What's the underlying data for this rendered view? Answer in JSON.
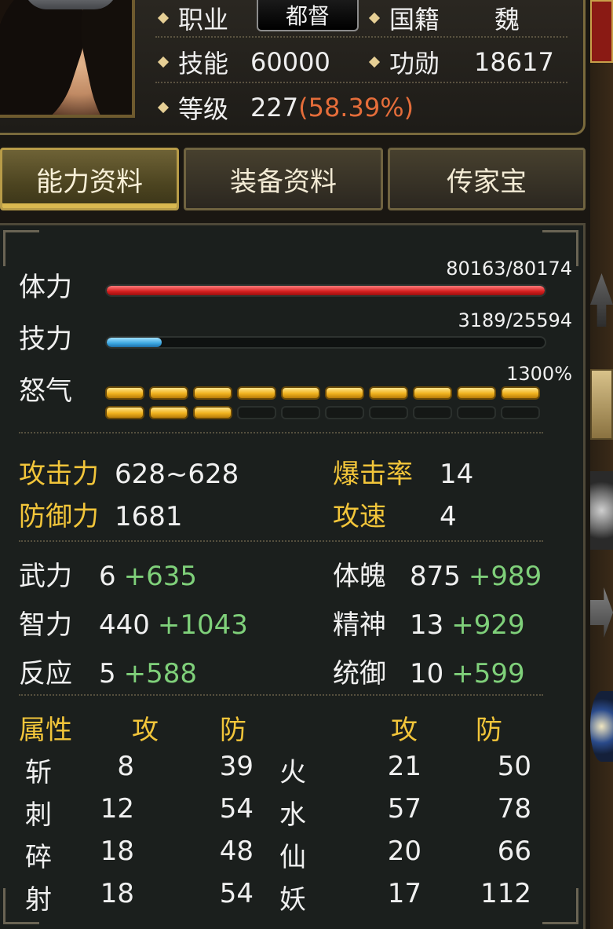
{
  "header": {
    "job_label": "职业",
    "job_value": "都督",
    "nation_label": "国籍",
    "nation_value": "魏",
    "skill_label": "技能",
    "skill_value": "60000",
    "merit_label": "功勋",
    "merit_value": "18617",
    "level_label": "等级",
    "level_value": "227",
    "level_pct": "(58.39%)"
  },
  "tabs": [
    {
      "label": "能力资料",
      "active": true
    },
    {
      "label": "装备资料",
      "active": false
    },
    {
      "label": "传家宝",
      "active": false
    }
  ],
  "bars": {
    "hp": {
      "label": "体力",
      "text": "80163/80174",
      "current": 80163,
      "max": 80174
    },
    "mp": {
      "label": "技力",
      "text": "3189/25594",
      "current": 3189,
      "max": 25594
    },
    "rage": {
      "label": "怒气",
      "text": "1300%",
      "filled_segments": 13,
      "total_segments": 20
    }
  },
  "combat": {
    "attack": {
      "label": "攻击力",
      "value": "628~628"
    },
    "crit": {
      "label": "爆击率",
      "value": "14"
    },
    "defense": {
      "label": "防御力",
      "value": "1681"
    },
    "speed": {
      "label": "攻速",
      "value": "4"
    }
  },
  "attributes": {
    "str": {
      "label": "武力",
      "base": "6",
      "bonus": "+635"
    },
    "con": {
      "label": "体魄",
      "base": "875",
      "bonus": "+989"
    },
    "int": {
      "label": "智力",
      "base": "440",
      "bonus": "+1043"
    },
    "spi": {
      "label": "精神",
      "base": "13",
      "bonus": "+929"
    },
    "agi": {
      "label": "反应",
      "base": "5",
      "bonus": "+588"
    },
    "cmd": {
      "label": "统御",
      "base": "10",
      "bonus": "+599"
    }
  },
  "resist": {
    "header": {
      "name": "属性",
      "atk": "攻",
      "def": "防",
      "atk2": "攻",
      "def2": "防"
    },
    "rows": [
      {
        "n1": "斩",
        "a1": "8",
        "d1": "39",
        "n2": "火",
        "a2": "21",
        "d2": "50"
      },
      {
        "n1": "刺",
        "a1": "12",
        "d1": "54",
        "n2": "水",
        "a2": "57",
        "d2": "78"
      },
      {
        "n1": "碎",
        "a1": "18",
        "d1": "48",
        "n2": "仙",
        "a2": "20",
        "d2": "66"
      },
      {
        "n1": "射",
        "a1": "18",
        "d1": "54",
        "n2": "妖",
        "a2": "17",
        "d2": "112"
      }
    ]
  },
  "colors": {
    "gold_label": "#f2c53a",
    "bonus_green": "#7fd07a",
    "level_pct": "#e56d3a",
    "hp_bar": "#d41e1e",
    "mp_bar": "#3ba6e0",
    "rage_bar": "#f0b21e"
  }
}
